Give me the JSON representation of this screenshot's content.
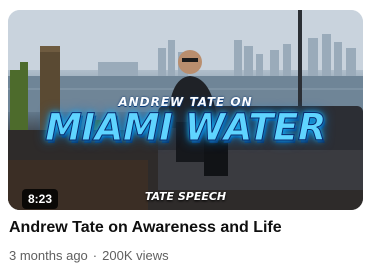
{
  "video": {
    "title": "Andrew Tate on Awareness and Life",
    "published": "3 months ago",
    "separator": "·",
    "views": "200K views",
    "duration": "8:23"
  },
  "thumbnail": {
    "kicker": "ANDREW TATE ON",
    "headline": "MIAMI WATER",
    "tag": "TATE SPEECH",
    "colors": {
      "headline_fill": "#5fd4ff",
      "headline_glow": "#1ec2ff",
      "headline_outline": "#0a2a6e"
    }
  }
}
